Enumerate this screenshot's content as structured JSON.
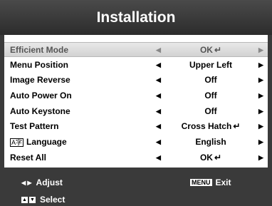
{
  "title": "Installation",
  "rows": [
    {
      "label": "Efficient Mode",
      "value": "OK",
      "enter": true,
      "selected": true
    },
    {
      "label": "Menu Position",
      "value": "Upper Left",
      "enter": false
    },
    {
      "label": "Image Reverse",
      "value": "Off",
      "enter": false
    },
    {
      "label": "Auto Power On",
      "value": "Off",
      "enter": false
    },
    {
      "label": "Auto Keystone",
      "value": "Off",
      "enter": false
    },
    {
      "label": "Test Pattern",
      "value": "Cross Hatch",
      "enter": true
    },
    {
      "label": "Language",
      "value": "English",
      "enter": false,
      "icon": "A字"
    },
    {
      "label": "Reset All",
      "value": "OK",
      "enter": true
    }
  ],
  "glyphs": {
    "arrow_left": "◀",
    "arrow_right": "▶",
    "enter": "↵",
    "up": "▲",
    "down": "▼"
  },
  "footer": {
    "adjust_label": "Adjust",
    "select_label": "Select",
    "menu_key": "MENU",
    "exit_label": "Exit"
  },
  "colors": {
    "title_bg": "#3a3a3a",
    "footer_bg": "#3a3a3a",
    "selected_row_bg": "#dcdcdc"
  }
}
